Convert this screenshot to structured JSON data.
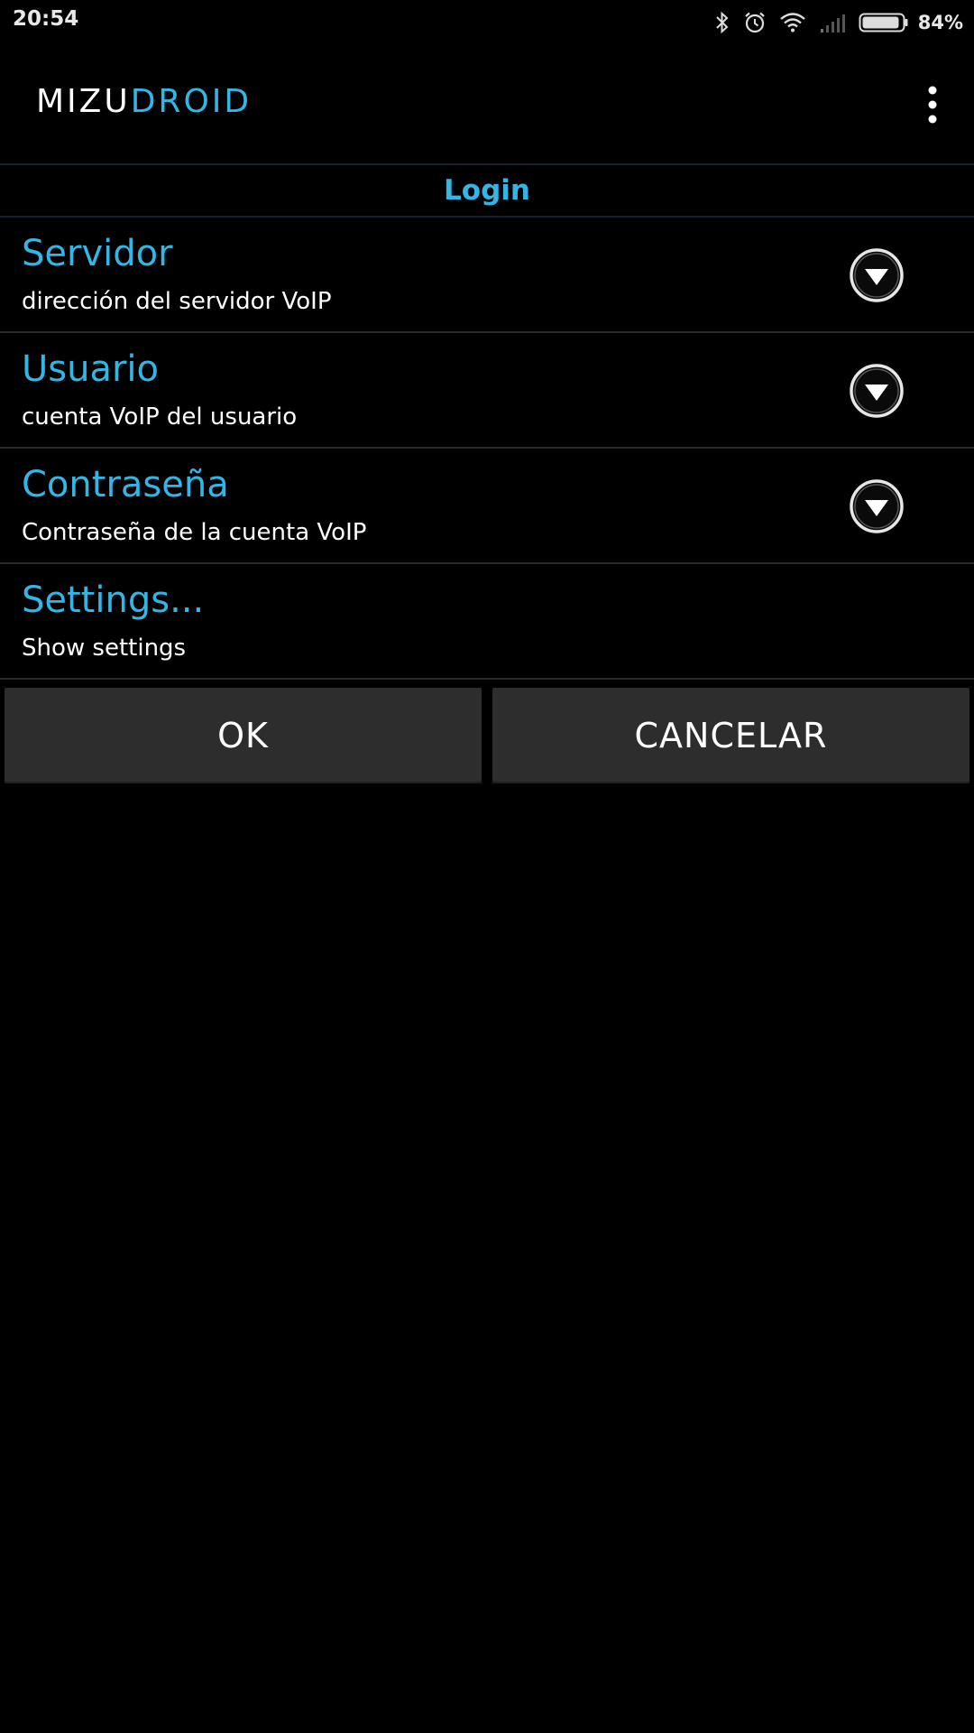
{
  "status_bar": {
    "time": "20:54",
    "icons": [
      "bluetooth-icon",
      "alarm-icon",
      "wifi-icon",
      "signal-icon",
      "battery-icon"
    ],
    "battery_percent": "84%"
  },
  "app_bar": {
    "logo_part1": "MIZU",
    "logo_part2": "DROID",
    "overflow_icon": "more-vert-icon",
    "accent_color": "#33b5e5"
  },
  "section_header": "Login",
  "preferences": [
    {
      "title": "Servidor",
      "summary": "dirección del servidor VoIP",
      "has_dropdown": true
    },
    {
      "title": "Usuario",
      "summary": "cuenta VoIP del usuario",
      "has_dropdown": true
    },
    {
      "title": "Contraseña",
      "summary": "Contraseña de la cuenta VoIP",
      "has_dropdown": true
    },
    {
      "title": "Settings...",
      "summary": "Show settings",
      "has_dropdown": false
    }
  ],
  "buttons": {
    "ok_label": "OK",
    "cancel_label": "CANCELAR"
  }
}
